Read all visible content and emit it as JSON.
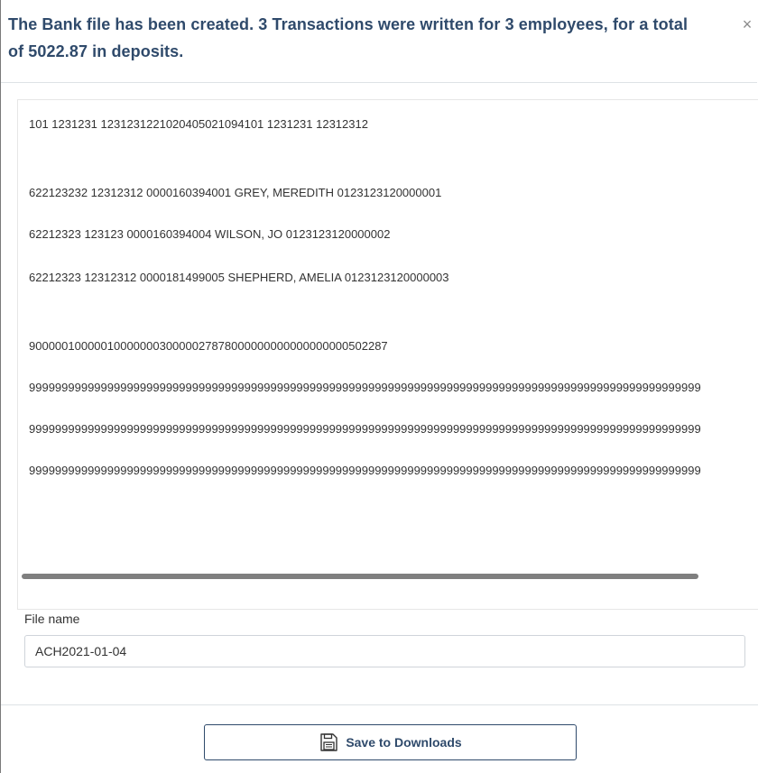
{
  "dialog": {
    "message": "The Bank file has been created. 3 Transactions were written for 3 employees, for a total of 5022.87 in deposits.",
    "close_glyph": "×"
  },
  "bank_file": {
    "lines": [
      "101 1231231 1231231221020405021094101 1231231 12312312",
      "",
      "622123232 12312312 0000160394001 GREY, MEREDITH 0123123120000001",
      "62212323 123123 0000160394004 WILSON, JO 0123123120000002",
      "62212323 12312312 0000181499005 SHEPHERD, AMELIA 0123123120000003",
      "",
      "9000001000001000000030000027878000000000000000000502287",
      "9999999999999999999999999999999999999999999999999999999999999999999999999999999999999999999999999999999",
      "9999999999999999999999999999999999999999999999999999999999999999999999999999999999999999999999999999999",
      "9999999999999999999999999999999999999999999999999999999999999999999999999999999999999999999999999999999"
    ]
  },
  "file_name": {
    "label": "File name",
    "value": "ACH2021-01-04"
  },
  "save_button": {
    "label": "Save to Downloads",
    "icon": "floppy-disk-icon"
  },
  "colors": {
    "title": "#2f4a6b",
    "border": "#dee2e6",
    "scrollbar": "#7f7f7f"
  }
}
